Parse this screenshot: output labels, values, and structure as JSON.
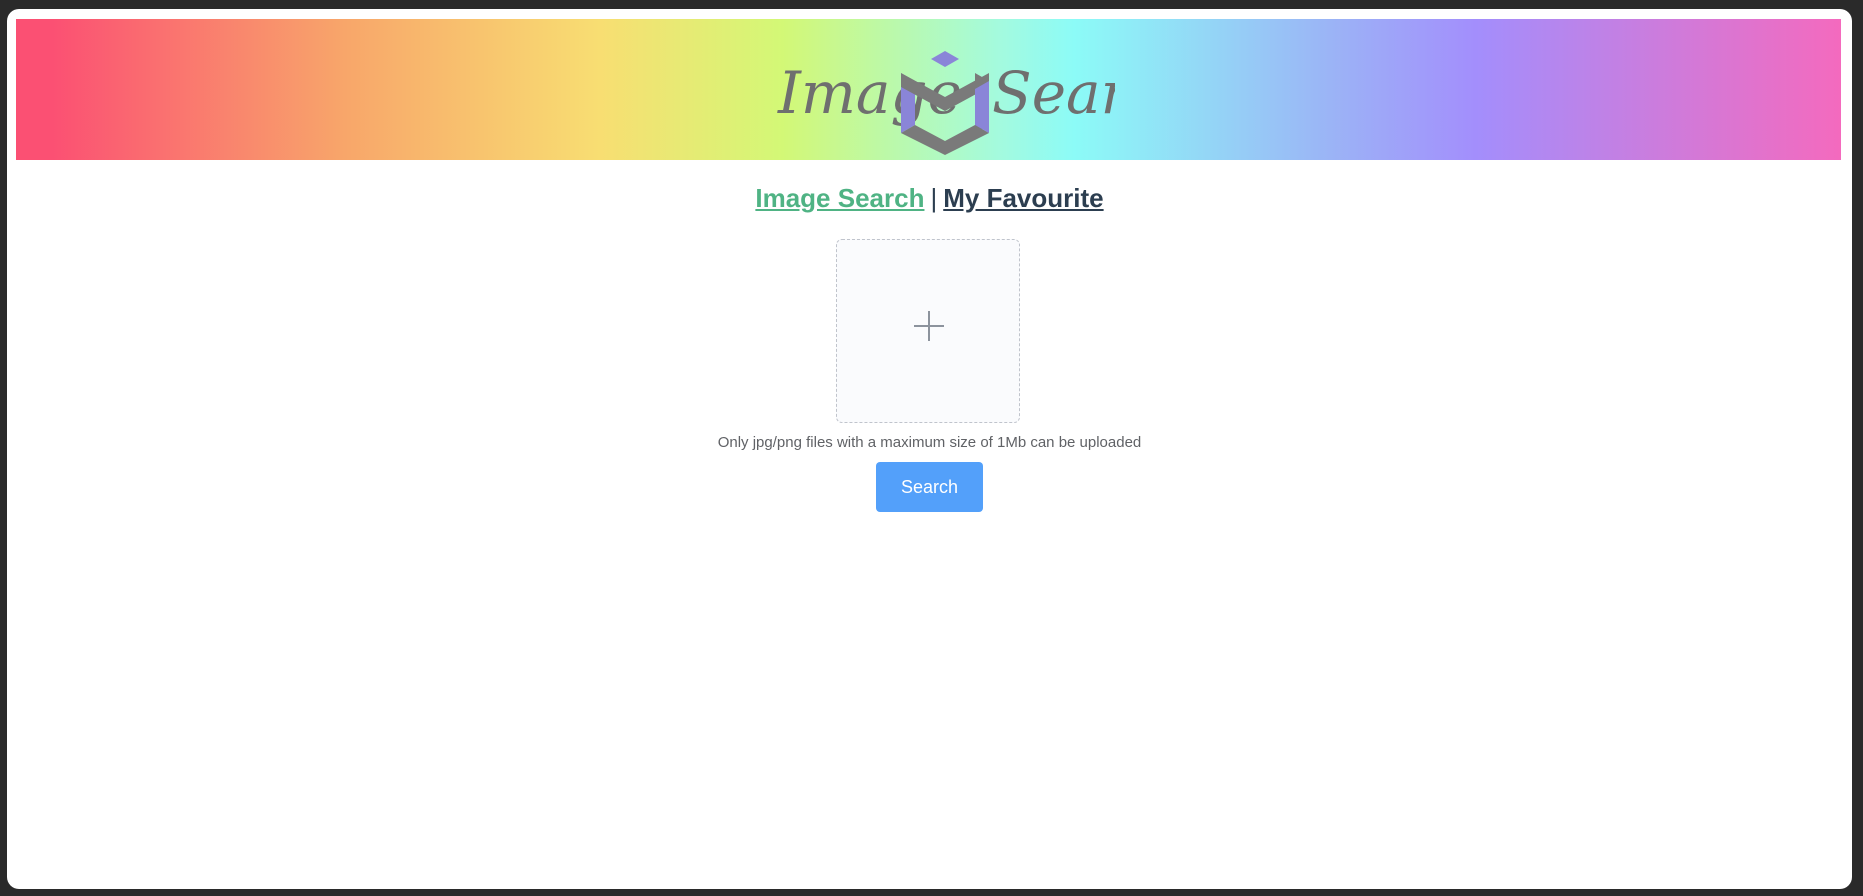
{
  "header": {
    "logo_text": "Image Search",
    "logo_word_left": "Image",
    "logo_word_right": "Search",
    "logo_icon": "cube-icon"
  },
  "nav": {
    "items": [
      {
        "label": "Image Search",
        "active": true
      },
      {
        "label": "My Favourite",
        "active": false
      }
    ],
    "separator": "|"
  },
  "upload": {
    "icon": "plus-icon",
    "hint": "Only jpg/png files with a maximum size of 1Mb can be uploaded"
  },
  "actions": {
    "search_label": "Search"
  },
  "colors": {
    "accent": "#53a0fa",
    "active_link": "#4fb384",
    "inactive_link": "#2c3e50"
  }
}
